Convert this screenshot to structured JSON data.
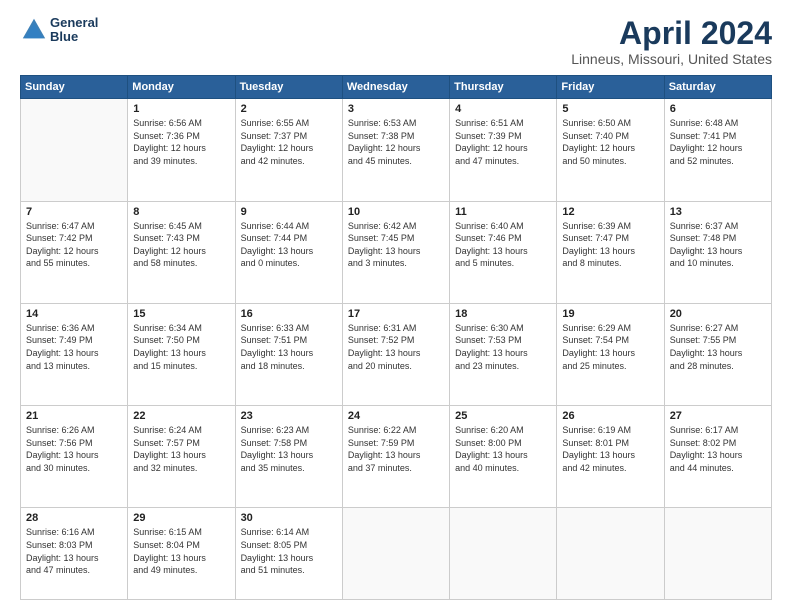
{
  "header": {
    "logo_line1": "General",
    "logo_line2": "Blue",
    "title": "April 2024",
    "location": "Linneus, Missouri, United States"
  },
  "days_of_week": [
    "Sunday",
    "Monday",
    "Tuesday",
    "Wednesday",
    "Thursday",
    "Friday",
    "Saturday"
  ],
  "weeks": [
    [
      {
        "day": "",
        "info": ""
      },
      {
        "day": "1",
        "info": "Sunrise: 6:56 AM\nSunset: 7:36 PM\nDaylight: 12 hours\nand 39 minutes."
      },
      {
        "day": "2",
        "info": "Sunrise: 6:55 AM\nSunset: 7:37 PM\nDaylight: 12 hours\nand 42 minutes."
      },
      {
        "day": "3",
        "info": "Sunrise: 6:53 AM\nSunset: 7:38 PM\nDaylight: 12 hours\nand 45 minutes."
      },
      {
        "day": "4",
        "info": "Sunrise: 6:51 AM\nSunset: 7:39 PM\nDaylight: 12 hours\nand 47 minutes."
      },
      {
        "day": "5",
        "info": "Sunrise: 6:50 AM\nSunset: 7:40 PM\nDaylight: 12 hours\nand 50 minutes."
      },
      {
        "day": "6",
        "info": "Sunrise: 6:48 AM\nSunset: 7:41 PM\nDaylight: 12 hours\nand 52 minutes."
      }
    ],
    [
      {
        "day": "7",
        "info": "Sunrise: 6:47 AM\nSunset: 7:42 PM\nDaylight: 12 hours\nand 55 minutes."
      },
      {
        "day": "8",
        "info": "Sunrise: 6:45 AM\nSunset: 7:43 PM\nDaylight: 12 hours\nand 58 minutes."
      },
      {
        "day": "9",
        "info": "Sunrise: 6:44 AM\nSunset: 7:44 PM\nDaylight: 13 hours\nand 0 minutes."
      },
      {
        "day": "10",
        "info": "Sunrise: 6:42 AM\nSunset: 7:45 PM\nDaylight: 13 hours\nand 3 minutes."
      },
      {
        "day": "11",
        "info": "Sunrise: 6:40 AM\nSunset: 7:46 PM\nDaylight: 13 hours\nand 5 minutes."
      },
      {
        "day": "12",
        "info": "Sunrise: 6:39 AM\nSunset: 7:47 PM\nDaylight: 13 hours\nand 8 minutes."
      },
      {
        "day": "13",
        "info": "Sunrise: 6:37 AM\nSunset: 7:48 PM\nDaylight: 13 hours\nand 10 minutes."
      }
    ],
    [
      {
        "day": "14",
        "info": "Sunrise: 6:36 AM\nSunset: 7:49 PM\nDaylight: 13 hours\nand 13 minutes."
      },
      {
        "day": "15",
        "info": "Sunrise: 6:34 AM\nSunset: 7:50 PM\nDaylight: 13 hours\nand 15 minutes."
      },
      {
        "day": "16",
        "info": "Sunrise: 6:33 AM\nSunset: 7:51 PM\nDaylight: 13 hours\nand 18 minutes."
      },
      {
        "day": "17",
        "info": "Sunrise: 6:31 AM\nSunset: 7:52 PM\nDaylight: 13 hours\nand 20 minutes."
      },
      {
        "day": "18",
        "info": "Sunrise: 6:30 AM\nSunset: 7:53 PM\nDaylight: 13 hours\nand 23 minutes."
      },
      {
        "day": "19",
        "info": "Sunrise: 6:29 AM\nSunset: 7:54 PM\nDaylight: 13 hours\nand 25 minutes."
      },
      {
        "day": "20",
        "info": "Sunrise: 6:27 AM\nSunset: 7:55 PM\nDaylight: 13 hours\nand 28 minutes."
      }
    ],
    [
      {
        "day": "21",
        "info": "Sunrise: 6:26 AM\nSunset: 7:56 PM\nDaylight: 13 hours\nand 30 minutes."
      },
      {
        "day": "22",
        "info": "Sunrise: 6:24 AM\nSunset: 7:57 PM\nDaylight: 13 hours\nand 32 minutes."
      },
      {
        "day": "23",
        "info": "Sunrise: 6:23 AM\nSunset: 7:58 PM\nDaylight: 13 hours\nand 35 minutes."
      },
      {
        "day": "24",
        "info": "Sunrise: 6:22 AM\nSunset: 7:59 PM\nDaylight: 13 hours\nand 37 minutes."
      },
      {
        "day": "25",
        "info": "Sunrise: 6:20 AM\nSunset: 8:00 PM\nDaylight: 13 hours\nand 40 minutes."
      },
      {
        "day": "26",
        "info": "Sunrise: 6:19 AM\nSunset: 8:01 PM\nDaylight: 13 hours\nand 42 minutes."
      },
      {
        "day": "27",
        "info": "Sunrise: 6:17 AM\nSunset: 8:02 PM\nDaylight: 13 hours\nand 44 minutes."
      }
    ],
    [
      {
        "day": "28",
        "info": "Sunrise: 6:16 AM\nSunset: 8:03 PM\nDaylight: 13 hours\nand 47 minutes."
      },
      {
        "day": "29",
        "info": "Sunrise: 6:15 AM\nSunset: 8:04 PM\nDaylight: 13 hours\nand 49 minutes."
      },
      {
        "day": "30",
        "info": "Sunrise: 6:14 AM\nSunset: 8:05 PM\nDaylight: 13 hours\nand 51 minutes."
      },
      {
        "day": "",
        "info": ""
      },
      {
        "day": "",
        "info": ""
      },
      {
        "day": "",
        "info": ""
      },
      {
        "day": "",
        "info": ""
      }
    ]
  ]
}
